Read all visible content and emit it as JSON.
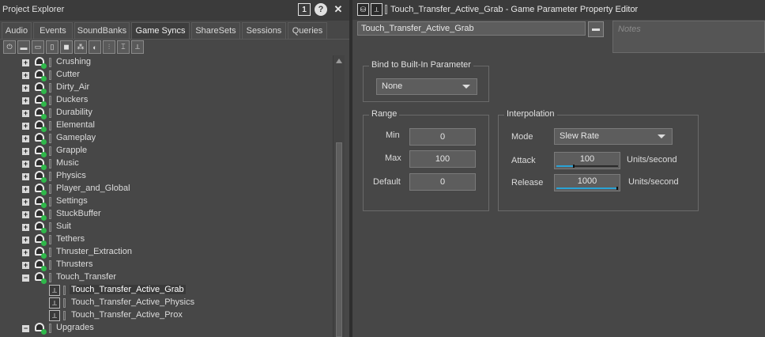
{
  "project_explorer": {
    "title": "Project Explorer",
    "title_buttons": {
      "pin": "1",
      "help": "?",
      "close": "✕"
    },
    "tabs": [
      "Audio",
      "Events",
      "SoundBanks",
      "Game Syncs",
      "ShareSets",
      "Sessions",
      "Queries"
    ],
    "active_tab": "Game Syncs",
    "tree": [
      {
        "label": "Crushing",
        "expander": "+"
      },
      {
        "label": "Cutter",
        "expander": "+"
      },
      {
        "label": "Dirty_Air",
        "expander": "+"
      },
      {
        "label": "Duckers",
        "expander": "+"
      },
      {
        "label": "Durability",
        "expander": "+"
      },
      {
        "label": "Elemental",
        "expander": "+"
      },
      {
        "label": "Gameplay",
        "expander": "+"
      },
      {
        "label": "Grapple",
        "expander": "+"
      },
      {
        "label": "Music",
        "expander": "+"
      },
      {
        "label": "Physics",
        "expander": "+"
      },
      {
        "label": "Player_and_Global",
        "expander": "+"
      },
      {
        "label": "Settings",
        "expander": "+"
      },
      {
        "label": "StuckBuffer",
        "expander": "+"
      },
      {
        "label": "Suit",
        "expander": "+"
      },
      {
        "label": "Tethers",
        "expander": "+"
      },
      {
        "label": "Thruster_Extraction",
        "expander": "+"
      },
      {
        "label": "Thrusters",
        "expander": "+"
      },
      {
        "label": "Touch_Transfer",
        "expander": "−"
      },
      {
        "label": "Touch_Transfer_Active_Grab",
        "child": true,
        "selected": true
      },
      {
        "label": "Touch_Transfer_Active_Physics",
        "child": true
      },
      {
        "label": "Touch_Transfer_Active_Prox",
        "child": true
      },
      {
        "label": "Upgrades",
        "expander": "−"
      }
    ]
  },
  "editor": {
    "title": "Touch_Transfer_Active_Grab - Game Parameter Property Editor",
    "name_value": "Touch_Transfer_Active_Grab",
    "notes_placeholder": "Notes",
    "bind": {
      "label": "Bind to Built-In Parameter",
      "value": "None"
    },
    "range": {
      "label": "Range",
      "min_label": "Min",
      "min_value": "0",
      "max_label": "Max",
      "max_value": "100",
      "default_label": "Default",
      "default_value": "0"
    },
    "interpolation": {
      "label": "Interpolation",
      "mode_label": "Mode",
      "mode_value": "Slew Rate",
      "attack_label": "Attack",
      "attack_value": "100",
      "attack_units": "Units/second",
      "attack_level": 0.3,
      "release_label": "Release",
      "release_value": "1000",
      "release_units": "Units/second",
      "release_level": 1.0
    }
  },
  "colors": {
    "accent": "#29a3d6",
    "icon_green": "#2fb84a"
  }
}
